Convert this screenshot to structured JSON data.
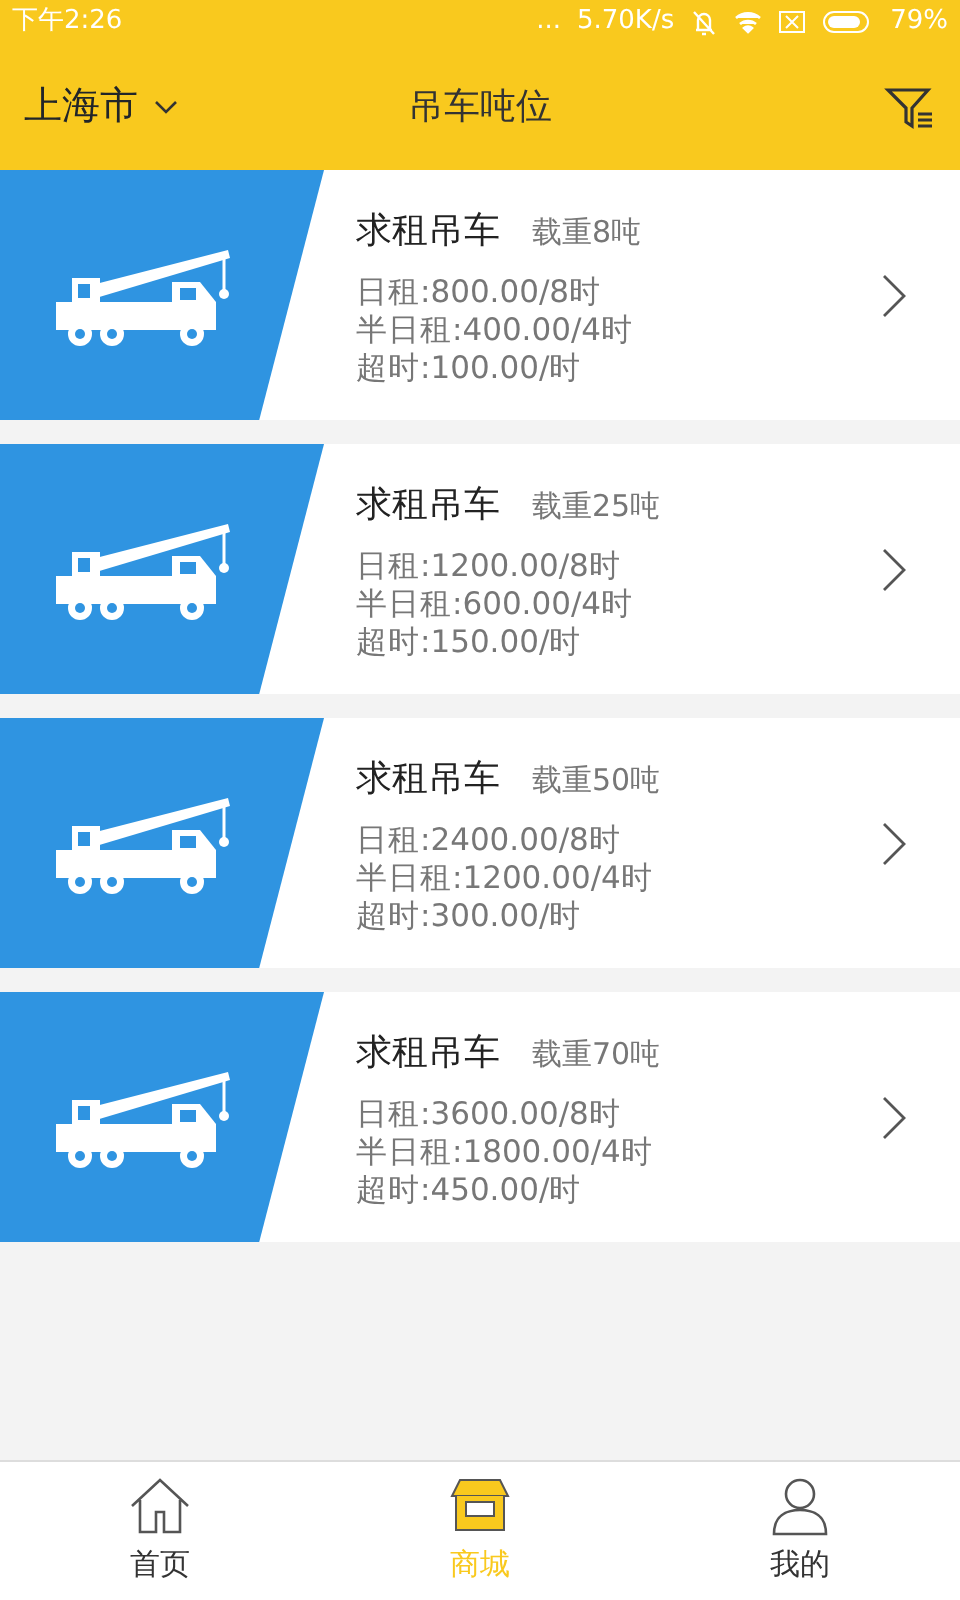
{
  "status_bar": {
    "time": "下午2:26",
    "dots": "...",
    "speed": "5.70K/s",
    "battery": "79%"
  },
  "header": {
    "city": "上海市",
    "title": "吊车吨位"
  },
  "listings": [
    {
      "title": "求租吊车",
      "capacity": "载重8吨",
      "lines": [
        "日租:800.00/8时",
        "半日租:400.00/4时",
        "超时:100.00/时"
      ]
    },
    {
      "title": "求租吊车",
      "capacity": "载重25吨",
      "lines": [
        "日租:1200.00/8时",
        "半日租:600.00/4时",
        "超时:150.00/时"
      ]
    },
    {
      "title": "求租吊车",
      "capacity": "载重50吨",
      "lines": [
        "日租:2400.00/8时",
        "半日租:1200.00/4时",
        "超时:300.00/时"
      ]
    },
    {
      "title": "求租吊车",
      "capacity": "载重70吨",
      "lines": [
        "日租:3600.00/8时",
        "半日租:1800.00/4时",
        "超时:450.00/时"
      ]
    }
  ],
  "tab_bar": [
    {
      "kind": "home",
      "label": "首页",
      "selected": false
    },
    {
      "kind": "shop",
      "label": "商城",
      "selected": true
    },
    {
      "kind": "profile",
      "label": "我的",
      "selected": false
    }
  ]
}
